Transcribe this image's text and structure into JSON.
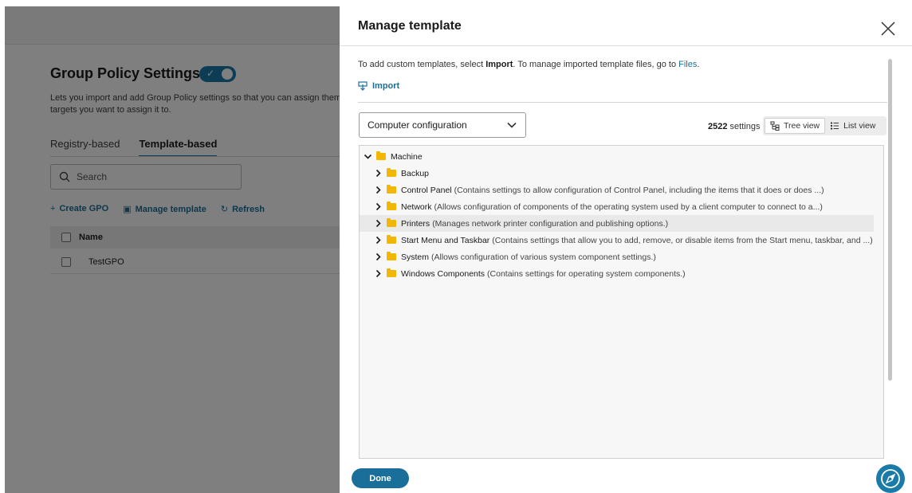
{
  "background": {
    "title": "Group Policy Settings",
    "description_line1": "Lets you import and add Group Policy settings so that you can assign them",
    "description_line2": "targets you want to assign it to.",
    "tabs": [
      {
        "label": "Registry-based"
      },
      {
        "label": "Template-based",
        "active": true
      }
    ],
    "search_placeholder": "Search",
    "actions": {
      "create": "Create GPO",
      "manage": "Manage template",
      "refresh": "Refresh"
    },
    "table": {
      "header": "Name",
      "rows": [
        "TestGPO"
      ]
    }
  },
  "modal": {
    "title": "Manage template",
    "intro_prefix": "To add custom templates, select ",
    "intro_bold": "Import",
    "intro_middle": ". To manage imported template files, go to ",
    "intro_link": "Files",
    "intro_suffix": ".",
    "import_label": "Import",
    "config_select": "Computer configuration",
    "settings_count": "2522",
    "settings_label": "settings",
    "view_tree": "Tree view",
    "view_list": "List view",
    "tree": [
      {
        "label": "Machine",
        "desc": "",
        "expanded": true
      },
      {
        "label": "Backup",
        "desc": ""
      },
      {
        "label": "Control Panel",
        "desc": "(Contains settings to allow configuration of Control Panel, including the items that it does or does ...)"
      },
      {
        "label": "Network",
        "desc": "(Allows configuration of components of the operating system used by a client computer to connect to a...)"
      },
      {
        "label": "Printers",
        "desc": "(Manages network printer configuration and publishing options.)",
        "highlighted": true
      },
      {
        "label": "Start Menu and Taskbar",
        "desc": "(Contains settings that allow you to add, remove, or disable items from the Start menu, taskbar, and ...)"
      },
      {
        "label": "System",
        "desc": "(Allows configuration of various system component settings.)"
      },
      {
        "label": "Windows Components",
        "desc": "(Contains settings for operating system components.)"
      }
    ],
    "done_label": "Done"
  },
  "colors": {
    "accent": "#1a6f9a",
    "folder": "#f2b705",
    "fab": "#1a7ba8"
  },
  "icons": [
    "close-icon",
    "import-icon",
    "chevron-down-icon",
    "tree-view-icon",
    "list-view-icon",
    "chevron-right-icon",
    "folder-icon",
    "navigation-icon"
  ]
}
